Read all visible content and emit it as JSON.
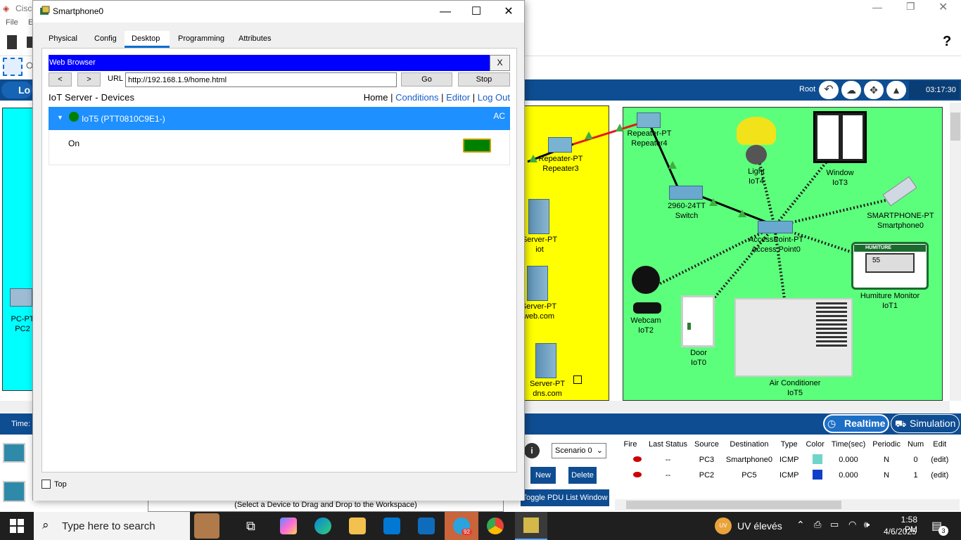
{
  "background_app": {
    "title": "Cisco",
    "menu": [
      "File",
      "E"
    ],
    "help_glyph": "?",
    "logical_tab": "Lo",
    "root_label": "Root",
    "clock": "03:17:30",
    "time_label": "Time:",
    "mode_realtime": "Realtime",
    "mode_simulation": "Simulation",
    "scenario_select": "Scenario 0",
    "new_button": "New",
    "delete_button": "Delete",
    "toggle_pdu_button": "Toggle PDU List Window",
    "drag_hint": "(Select a Device to Drag and Drop to the Workspace)",
    "pdu_columns": [
      "Fire",
      "Last Status",
      "Source",
      "Destination",
      "Type",
      "Color",
      "Time(sec)",
      "Periodic",
      "Num",
      "Edit"
    ],
    "pdu_rows": [
      {
        "last_status": "--",
        "source": "PC3",
        "destination": "Smartphone0",
        "type": "ICMP",
        "color": "#6fd5c9",
        "time": "0.000",
        "periodic": "N",
        "num": "0",
        "edit": "(edit)"
      },
      {
        "last_status": "--",
        "source": "PC2",
        "destination": "PC5",
        "type": "ICMP",
        "color": "#1040c8",
        "time": "0.000",
        "periodic": "N",
        "num": "1",
        "edit": "(edit)"
      }
    ],
    "devices": {
      "pc2": "PC-PT\nPC2",
      "repeater3": "Repeater-PT\nRepeater3",
      "repeater4": "Repeater-PT\nRepeater4",
      "server_iot": "Server-PT\niot",
      "server_web": "Server-PT\nweb.com",
      "server_dns": "Server-PT\ndns.com",
      "switch": "2960-24TT\nSwitch",
      "access_point": "AccessPoint-PT\nAccess Point0",
      "light": "Light\nIoT4",
      "window": "Window\nIoT3",
      "smartphone": "SMARTPHONE-PT\nSmartphone0",
      "humiture": "Humiture Monitor\nIoT1",
      "humiture_brand": "HUMITURE",
      "humiture_value": "55",
      "webcam": "Webcam\nIoT2",
      "door": "Door\nIoT0",
      "aircon": "Air Conditioner\nIoT5"
    }
  },
  "smartphone_window": {
    "title": "Smartphone0",
    "tabs": [
      "Physical",
      "Config",
      "Desktop",
      "Programming",
      "Attributes"
    ],
    "active_tab": "Desktop",
    "top_checkbox_label": "Top",
    "browser": {
      "title": "Web Browser",
      "close_label": "X",
      "back_label": "<",
      "forward_label": ">",
      "url_label": "URL",
      "url_value": "http://192.168.1.9/home.html",
      "go_label": "Go",
      "stop_label": "Stop",
      "page_title": "IoT Server - Devices",
      "nav": [
        "Home",
        "Conditions",
        "Editor",
        "Log Out"
      ],
      "device_name": "IoT5 (PTT0810C9E1-)",
      "device_type": "AC",
      "device_state": "On",
      "status_color": "#008000"
    }
  },
  "taskbar": {
    "search_placeholder": "Type here to search",
    "weather": "UV élevés",
    "weather_badge": "UV",
    "time": "1:58 PM",
    "date": "4/6/2025",
    "telegram_badge": "92",
    "notification_count": "3"
  }
}
